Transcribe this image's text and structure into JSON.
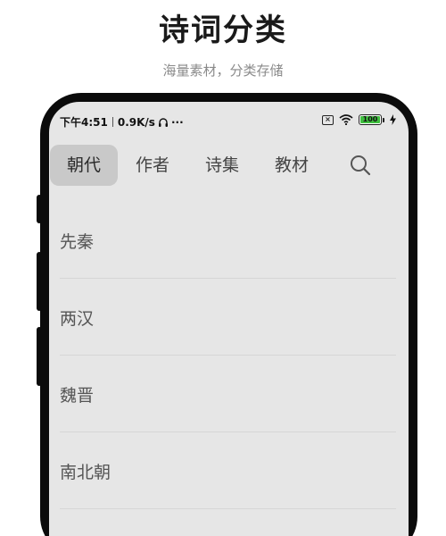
{
  "hero": {
    "title": "诗词分类",
    "subtitle": "海量素材，分类存储"
  },
  "status_bar": {
    "time": "下午4:51",
    "speed": "0.9K/s",
    "headphone_icon": "headphone-icon",
    "more": "···",
    "battery": "100"
  },
  "tabs": [
    {
      "label": "朝代",
      "active": true
    },
    {
      "label": "作者",
      "active": false
    },
    {
      "label": "诗集",
      "active": false
    },
    {
      "label": "教材",
      "active": false
    }
  ],
  "list": {
    "items": [
      {
        "label": "先秦"
      },
      {
        "label": "两汉"
      },
      {
        "label": "魏晋"
      },
      {
        "label": "南北朝"
      }
    ]
  },
  "colors": {
    "screen_bg": "#e6e6e6",
    "active_tab_bg": "#c9c9c9",
    "phone_frame": "#0b0b0b",
    "battery_green": "#3fbf3f"
  }
}
